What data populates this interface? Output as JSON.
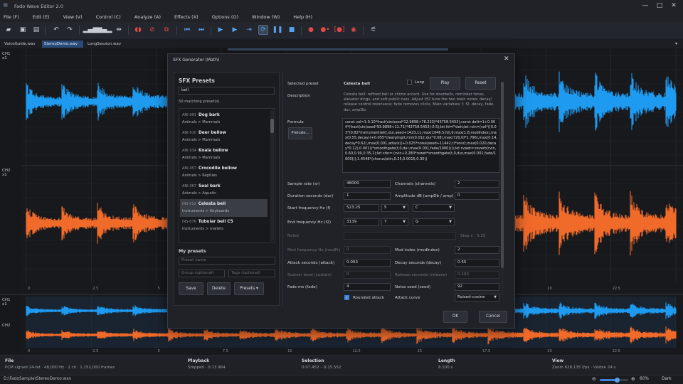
{
  "window": {
    "title": "Fado Wave Editor 2.0",
    "minimize_icon": "minimize-icon",
    "maximize_icon": "maximize-icon",
    "close_icon": "close-icon"
  },
  "menu": [
    "File (F)",
    "Edit (E)",
    "View (V)",
    "Control (C)",
    "Analyze (A)",
    "Effects (X)",
    "Options (O)",
    "Window (W)",
    "Help (H)"
  ],
  "toolbar": {
    "icons": [
      "open-folder-icon",
      "save-icon",
      "save-as-icon",
      "undo-icon",
      "redo-icon",
      "spectrum-icon",
      "spectrum-alt-icon",
      "normalize-icon",
      "record-marker-icon",
      "mute-icon",
      "cut-icon",
      "skip-start-icon",
      "skip-end-icon",
      "play-start-icon",
      "play-icon",
      "play-selection-icon",
      "loop-icon",
      "pause-icon",
      "stop-icon",
      "record-icon",
      "record-alt-icon",
      "record-selection-icon",
      "record-stop-icon",
      "mixer-icon"
    ]
  },
  "tabs": [
    "VoiceGuide.wav",
    "StereoDemo.wav",
    "LongSession.wav"
  ],
  "active_tab": 1,
  "waveform": {
    "ch1_label": "CH1",
    "ch1_scale": "x1",
    "ch2_label": "CH2",
    "ch2_scale": "x1",
    "ch1_color": "#1e9bf0",
    "ch2_color": "#f06a2a",
    "time_ticks": [
      "0",
      "2.5",
      "5",
      "7.5",
      "10",
      "12.5",
      "15",
      "17.5",
      "20",
      "22.5"
    ],
    "overview_ch1": "CH1",
    "overview_ch1_scale": "x1",
    "overview_ch2": "CH2"
  },
  "status": {
    "file_label": "File",
    "file_value": "PCM signed 24-bit · 48,000 Hz · 2 ch · 1,152,000 frames",
    "playback_label": "Playback",
    "playback_value": "Stopped · 0:13.964",
    "selection_label": "Selection",
    "selection_value": "0:07.452 – 0:15.552",
    "length_label": "Length",
    "length_value": "8.100 s",
    "view_label": "View",
    "view_value": "Zoom 628,135 f/px · Visible 24 s"
  },
  "bottom": {
    "path": "D:\\FadoSample\\StereoDemo.wav",
    "zoom_percent": "60%",
    "zoom_level": 0.6,
    "theme": "Dark"
  },
  "dialog": {
    "title": "SFX Generator (Math)",
    "presets_heading": "SFX Presets",
    "search_value": "bell",
    "match_count": "50 matching preset(s).",
    "presets": [
      {
        "id": "ANI-001",
        "name": "Dog bark",
        "category": "Animals > Mammals"
      },
      {
        "id": "ANI-010",
        "name": "Deer bellow",
        "category": "Animals > Mammals"
      },
      {
        "id": "ANI-034",
        "name": "Koala bellow",
        "category": "Animals > Mammals"
      },
      {
        "id": "ANI-057",
        "name": "Crocodile bellow",
        "category": "Animals > Reptiles"
      },
      {
        "id": "ANI-067",
        "name": "Seal bark",
        "category": "Animals > Aquatic"
      },
      {
        "id": "INS-012",
        "name": "Celesta bell",
        "category": "Instruments > Keyboards"
      },
      {
        "id": "INS-076",
        "name": "Tubular bell C5",
        "category": "Instruments > mallets"
      }
    ],
    "selected_preset_index": 5,
    "my_presets_heading": "My presets",
    "preset_name_placeholder": "Preset name",
    "group_placeholder": "Group (optional)",
    "tags_placeholder": "Tags (optional)",
    "save_label": "Save",
    "delete_label": "Delete",
    "presets_menu_label": "Presets",
    "selected_preset_label": "Selected preset",
    "selected_preset_value": "Celesta bell",
    "loop_label": "Loop",
    "play_label": "Play",
    "reset_label": "Reset",
    "description_label": "Description",
    "description_text": "Celesta bell: refined bell or chime accent. Use for doorbells, reminder tones, elevator dings, and soft public cues. Adjust f/f2 tune the two main notes; decay/ release control resonance; fade removes clicks. Main variables: f, f2, decay, fade, dur, ampDb.",
    "formula_label": "Formula",
    "prelude_label": "Prelude...",
    "formula_text": "const vel=1-0.10*fract(sin(seed*12.9898+78.233)*43758.5453);const dett=1+0.004*(fract(sin(seed*93.9898+11.71)*43758.5453)-0.5);let fd=f*dett;let rvin=(vel*((0.03*(0.82*instrumentrel(t,dur,seed+1423,11,max(1046.5,fd),0,max(1.8,modIndex),max(0.55,decay))+0.055*clearping(t,min(0.012,dur*0.08),max(720,fd*1.796),max(0.14,decay*0.62),max(0.001,attack))+0.025*noise(seed+11442,t)*env(t,max(0.020,decay*0.12),0.001))*smoothgate(t,0,dur,max(0.001,fade/1000))));let rvwet=:reverb(rvin,0.60,0.90,0.35,1);let stin=:(rvin+0.280*rvwet*smoothgate(t,0,dur,max(0.001,fade/1000)));1.4548*(chorus(stin,0.25,0.0015,0.35))",
    "params": {
      "sample_rate_label": "Sample rate (sr)",
      "sample_rate": "48000",
      "channels_label": "Channels (channels)",
      "channels": "2",
      "duration_label": "Duration seconds (dur)",
      "duration": "1",
      "amplitude_label": "Amplitude dB (ampDb / amp)",
      "amplitude": "0",
      "start_freq_label": "Start frequency Hz (f)",
      "start_freq": "523.25",
      "start_octave": "5",
      "start_note": "C",
      "end_freq_label": "End frequency Hz (f2)",
      "end_freq": "3139",
      "end_octave": "7",
      "end_note": "G",
      "notes_label": "Notes",
      "step_label": "Step s",
      "step_value": "0.25",
      "mod_freq_label": "Mod frequency Hz (modFr)",
      "mod_freq": "0",
      "mod_index_label": "Mod index (modIndex)",
      "mod_index": "2",
      "attack_label": "Attack seconds (attack)",
      "attack": "0.003",
      "decay_label": "Decay seconds (decay)",
      "decay": "0.55",
      "sustain_label": "Sustain level (sustain)",
      "sustain": "0",
      "release_label": "Release seconds (release)",
      "release": "0.193",
      "fade_label": "Fade ms (fade)",
      "fade": "4",
      "noise_seed_label": "Noise seed (seed)",
      "noise_seed": "92",
      "rounded_attack_label": "Rounded attack",
      "attack_curve_label": "Attack curve",
      "attack_curve": "Raised-cosine"
    },
    "ok_label": "OK",
    "cancel_label": "Cancel"
  }
}
